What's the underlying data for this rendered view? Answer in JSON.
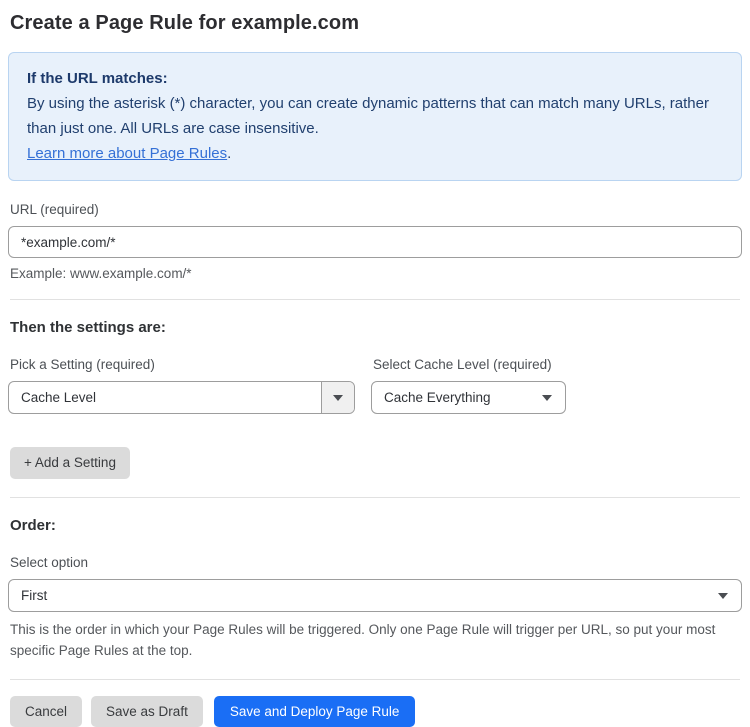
{
  "page": {
    "title": "Create a Page Rule for example.com"
  },
  "info_box": {
    "heading": "If the URL matches:",
    "body": "By using the asterisk (*) character, you can create dynamic patterns that can match many URLs, rather than just one. All URLs are case insensitive.",
    "link_label": "Learn more about Page Rules",
    "link_suffix": "."
  },
  "url_field": {
    "label": "URL (required)",
    "value": "*example.com/*",
    "helper": "Example: www.example.com/*"
  },
  "settings_section": {
    "heading": "Then the settings are:",
    "setting_picker": {
      "label": "Pick a Setting (required)",
      "value": "Cache Level"
    },
    "cache_level_picker": {
      "label": "Select Cache Level (required)",
      "value": "Cache Everything"
    },
    "add_setting_label": "+ Add a Setting"
  },
  "order_section": {
    "heading": "Order:",
    "label": "Select option",
    "value": "First",
    "helper": "This is the order in which your Page Rules will be triggered. Only one Page Rule will trigger per URL, so put your most specific Page Rules at the top."
  },
  "actions": {
    "cancel": "Cancel",
    "save_draft": "Save as Draft",
    "save_deploy": "Save and Deploy Page Rule"
  },
  "colors": {
    "accent_blue": "#1a6ef5",
    "link_blue": "#3470d6",
    "info_bg": "#e8f1fb",
    "info_border": "#b9d4f1",
    "info_text": "#21406f"
  }
}
